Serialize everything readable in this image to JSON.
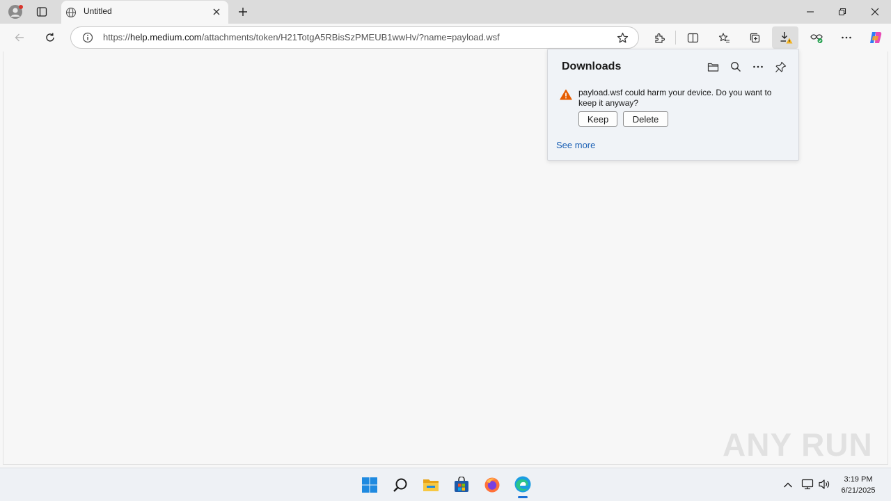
{
  "browser": {
    "tab_title": "Untitled",
    "url_prefix": "https://",
    "url_host": "help.medium.com",
    "url_path": "/attachments/token/H21TotgA5RBisSzPMEUB1wwHv/?name=payload.wsf"
  },
  "downloads": {
    "title": "Downloads",
    "warning_text": "payload.wsf could harm your device. Do you want to keep it anyway?",
    "keep_label": "Keep",
    "delete_label": "Delete",
    "see_more_label": "See more"
  },
  "watermark": "ANY RUN",
  "taskbar": {
    "time": "3:19 PM",
    "date": "6/21/2025"
  },
  "colors": {
    "accent": "#1a5fb4",
    "warning": "#e65c00"
  }
}
